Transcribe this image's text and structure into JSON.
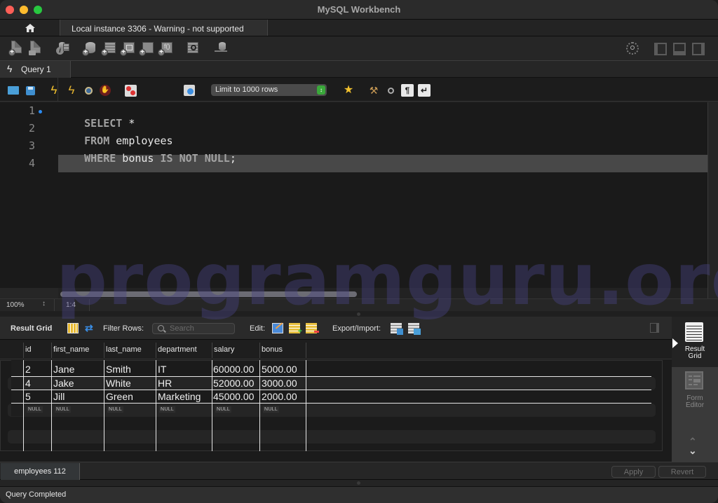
{
  "window": {
    "title": "MySQL Workbench"
  },
  "connection_tabs": {
    "home_icon": "home-icon",
    "active_tab": "Local instance 3306 - Warning - not supported"
  },
  "main_toolbar": {
    "icons": [
      "new-sql-tab-icon",
      "open-sql-script-icon",
      "schema-inspector-icon",
      "create-schema-icon",
      "create-table-icon",
      "create-view-icon",
      "create-procedure-icon",
      "create-function-icon",
      "search-table-data-icon",
      "reconnect-icon"
    ],
    "right_icons": [
      "preferences-icon",
      "toggle-sidebar-icon",
      "toggle-output-icon",
      "toggle-secondary-sidebar-icon"
    ]
  },
  "query_tabs": [
    {
      "label": "Query 1",
      "icon": "lightning-icon",
      "active": true
    }
  ],
  "sql_toolbar": {
    "icons": [
      "open-file-icon",
      "save-file-icon",
      "execute-icon",
      "execute-current-icon",
      "explain-icon",
      "stop-icon",
      "toggle-error-continue-icon",
      "commit-icon",
      "rollback-icon",
      "autocommit-icon",
      "add-snippet-icon",
      "beautify-icon",
      "find-icon",
      "invisible-chars-icon",
      "word-wrap-icon"
    ],
    "limit_select": {
      "value": "Limit to 1000 rows"
    }
  },
  "editor": {
    "lines": [
      {
        "number": "1",
        "tokens": [
          {
            "t": "SELECT",
            "k": "kw"
          },
          {
            "t": " *",
            "k": "id"
          }
        ]
      },
      {
        "number": "2",
        "tokens": [
          {
            "t": "FROM",
            "k": "kw"
          },
          {
            "t": " employees",
            "k": "id"
          }
        ]
      },
      {
        "number": "3",
        "tokens": [
          {
            "t": "WHERE",
            "k": "kw"
          },
          {
            "t": " bonus ",
            "k": "id"
          },
          {
            "t": "IS NOT NULL",
            "k": "kw"
          },
          {
            "t": ";",
            "k": "id"
          }
        ]
      },
      {
        "number": "4",
        "tokens": []
      }
    ],
    "zoom": "100%",
    "cursor_position": "1:4"
  },
  "watermark": "programguru.org",
  "result_toolbar": {
    "title": "Result Grid",
    "filter_label": "Filter Rows:",
    "search_placeholder": "Search",
    "edit_label": "Edit:",
    "export_label": "Export/Import:"
  },
  "result_grid": {
    "columns": [
      "id",
      "first_name",
      "last_name",
      "department",
      "salary",
      "bonus"
    ],
    "rows": [
      [
        "2",
        "Jane",
        "Smith",
        "IT",
        "60000.00",
        "5000.00"
      ],
      [
        "4",
        "Jake",
        "White",
        "HR",
        "52000.00",
        "3000.00"
      ],
      [
        "5",
        "Jill",
        "Green",
        "Marketing",
        "45000.00",
        "2000.00"
      ]
    ],
    "new_row": [
      "NULL",
      "NULL",
      "NULL",
      "NULL",
      "NULL",
      "NULL"
    ]
  },
  "side_panel": {
    "items": [
      {
        "label_1": "Result",
        "label_2": "Grid",
        "active": true
      },
      {
        "label_1": "Form",
        "label_2": "Editor",
        "active": false
      }
    ]
  },
  "result_tabs": [
    {
      "label": "employees 112",
      "active": true
    }
  ],
  "buttons": {
    "apply": "Apply",
    "revert": "Revert"
  },
  "status": {
    "text": "Query Completed"
  }
}
